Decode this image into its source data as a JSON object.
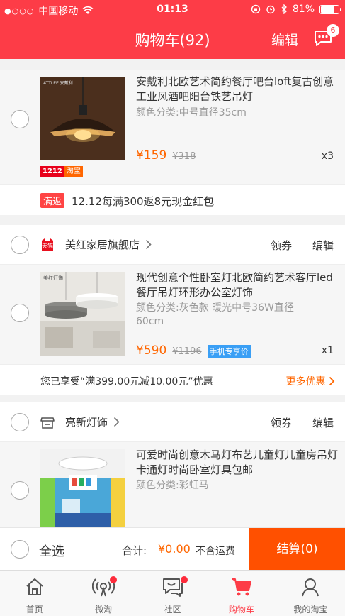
{
  "status_bar": {
    "carrier": "中国移动",
    "time": "01:13",
    "battery": "81%",
    "battery_level": 0.81
  },
  "nav": {
    "title": "购物车(92)",
    "edit": "编辑",
    "msg_count": "6"
  },
  "item_top": {
    "title": "安戴利北欧艺术简约餐厅吧台loft复古创意工业风酒吧阳台铁艺吊灯",
    "spec": "颜色分类:中号直径35cm",
    "price": "¥159",
    "old_price": "¥318",
    "qty": "x3",
    "tag_1212": "1212",
    "tag_taobao": "淘宝",
    "thumb_brand": "ATTLEE 安戴利"
  },
  "promo_top": {
    "badge": "满返",
    "text": "12.12每满300返8元现金红包"
  },
  "shop1": {
    "icon": "tmall-icon",
    "icon_text": "天猫",
    "name": "美红家居旗舰店",
    "coupon": "领券",
    "edit": "编辑",
    "item": {
      "title": "现代创意个性卧室灯北欧简约艺术客厅led餐厅吊灯环形办公室灯饰",
      "spec": "颜色分类:灰色款 暖光中号36W直径60cm",
      "price": "¥590",
      "old_price": "¥1196",
      "tag": "手机专享价",
      "qty": "x1",
      "thumb_brand": "美红灯饰"
    },
    "promo": {
      "text": "您已享受“满399.00元减10.00元”优惠",
      "more": "更多优惠"
    }
  },
  "shop2": {
    "icon": "store-icon",
    "name": "亮新灯饰",
    "coupon": "领券",
    "edit": "编辑",
    "item": {
      "title": "可爱时尚创意木马灯布艺儿童灯儿童房吊灯卡通灯时尚卧室灯具包邮",
      "spec": "颜色分类:彩虹马"
    }
  },
  "actionbar": {
    "select_all": "全选",
    "total_label": "合计:",
    "total_value": "¥0.00",
    "shipping": "不含运费",
    "checkout": "结算(0)"
  },
  "tabs": [
    {
      "label": "首页",
      "icon": "home-icon"
    },
    {
      "label": "微淘",
      "icon": "weitao-icon"
    },
    {
      "label": "社区",
      "icon": "community-icon"
    },
    {
      "label": "购物车",
      "icon": "cart-icon"
    },
    {
      "label": "我的淘宝",
      "icon": "profile-icon"
    }
  ],
  "colors": {
    "brand_red": "#fd3c47",
    "price_orange": "#ff6600",
    "checkout_orange": "#ff5000"
  }
}
